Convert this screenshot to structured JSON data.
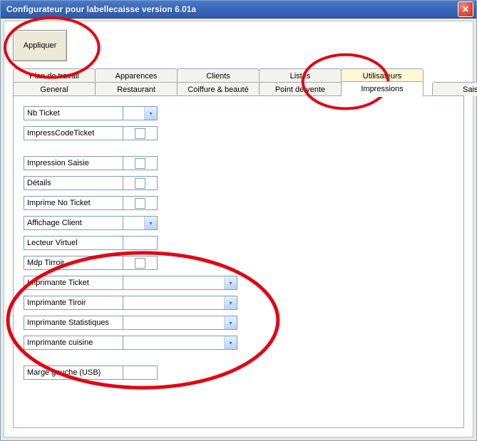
{
  "window": {
    "title": "Configurateur pour labellecaisse version 6.01a"
  },
  "buttons": {
    "apply": "Appliquer",
    "close_glyph": "✕"
  },
  "tabs_top": [
    {
      "label": "Plan de travail"
    },
    {
      "label": "Apparences"
    },
    {
      "label": "Clients"
    },
    {
      "label": "Listes"
    },
    {
      "label": "Utilisateurs",
      "highlight": true
    }
  ],
  "tabs_bottom": [
    {
      "label": "General"
    },
    {
      "label": "Restaurant"
    },
    {
      "label": "Coiffure & beauté"
    },
    {
      "label": "Point de vente"
    },
    {
      "label": "Impressions",
      "active": true
    },
    {
      "label": "Saisie"
    }
  ],
  "fields": {
    "nb_ticket": {
      "label": "Nb Ticket",
      "value": ""
    },
    "impress_code_ticket": {
      "label": "ImpressCodeTicket",
      "checked": false
    },
    "impression_saisie": {
      "label": "Impression Saisie",
      "checked": false
    },
    "details": {
      "label": "Détails",
      "checked": false
    },
    "imprime_no_ticket": {
      "label": "Imprime No Ticket",
      "checked": false
    },
    "affichage_client": {
      "label": "Affichage Client",
      "value": ""
    },
    "lecteur_virtuel": {
      "label": "Lecteur Virtuel",
      "value": ""
    },
    "mdp_tirroir": {
      "label": "Mdp Tirroir",
      "checked": false
    },
    "imprimante_ticket": {
      "label": "Imprimante Ticket",
      "value": ""
    },
    "imprimante_tiroir": {
      "label": "Imprimante Tiroir",
      "value": ""
    },
    "imprimante_statistiques": {
      "label": "Imprimante Statistiques",
      "value": ""
    },
    "imprimante_cuisine": {
      "label": "Imprimante cuisine",
      "value": ""
    },
    "marge_gauche_usb": {
      "label": "Marge gauche (USB)",
      "value": ""
    }
  },
  "glyphs": {
    "arrow_down": "▾"
  },
  "annotation_color": "#e30613"
}
